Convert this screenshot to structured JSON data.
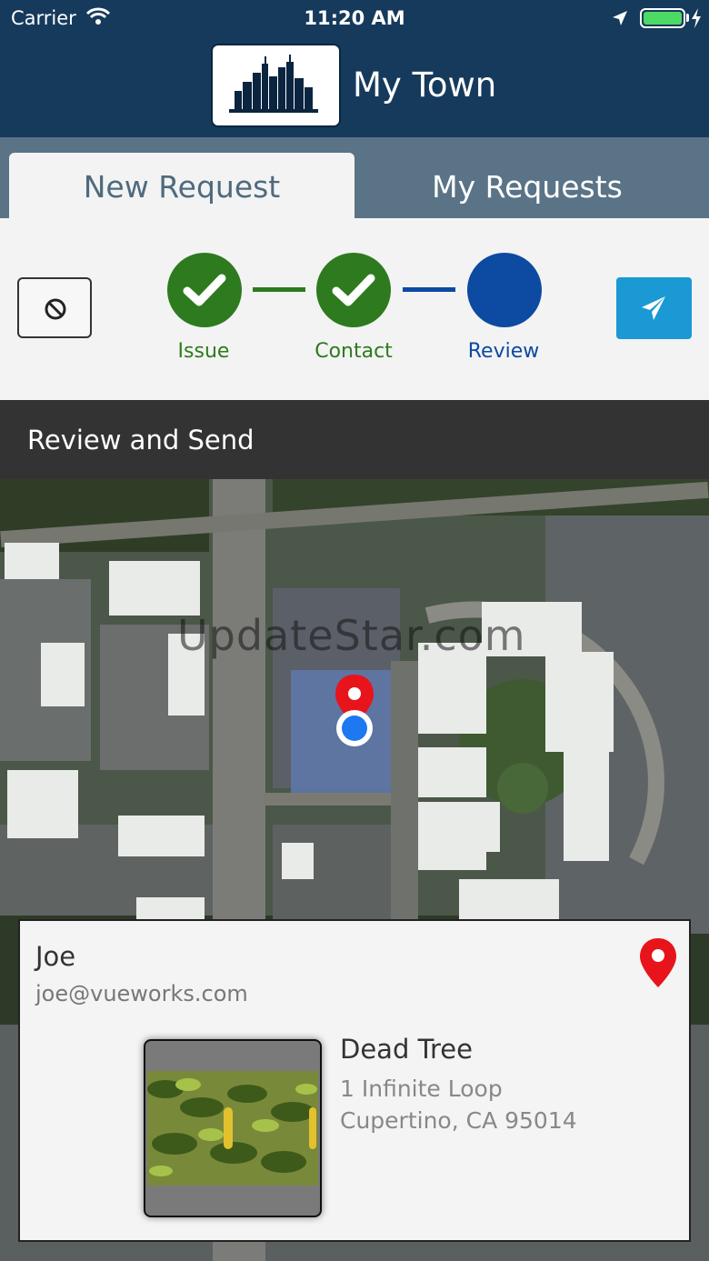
{
  "status_bar": {
    "carrier": "Carrier",
    "time": "11:20 AM"
  },
  "header": {
    "title": "My Town",
    "logo_icon": "city-skyline-icon"
  },
  "tabs": [
    {
      "label": "New Request",
      "active": true
    },
    {
      "label": "My Requests",
      "active": false
    }
  ],
  "steps": [
    {
      "label": "Issue",
      "state": "complete"
    },
    {
      "label": "Contact",
      "state": "complete"
    },
    {
      "label": "Review",
      "state": "active"
    }
  ],
  "colors": {
    "header": "#163a5c",
    "step_complete": "#2e7a1e",
    "step_active": "#0d4aa1",
    "send": "#1a99d4",
    "pin": "#e8141c"
  },
  "section": {
    "title": "Review and Send"
  },
  "map": {
    "watermark": "UpdateStar.com"
  },
  "summary": {
    "name": "Joe",
    "email": "joe@vueworks.com",
    "issue": "Dead Tree",
    "address_line1": "1 Infinite Loop",
    "address_line2": "Cupertino, CA 95014"
  }
}
